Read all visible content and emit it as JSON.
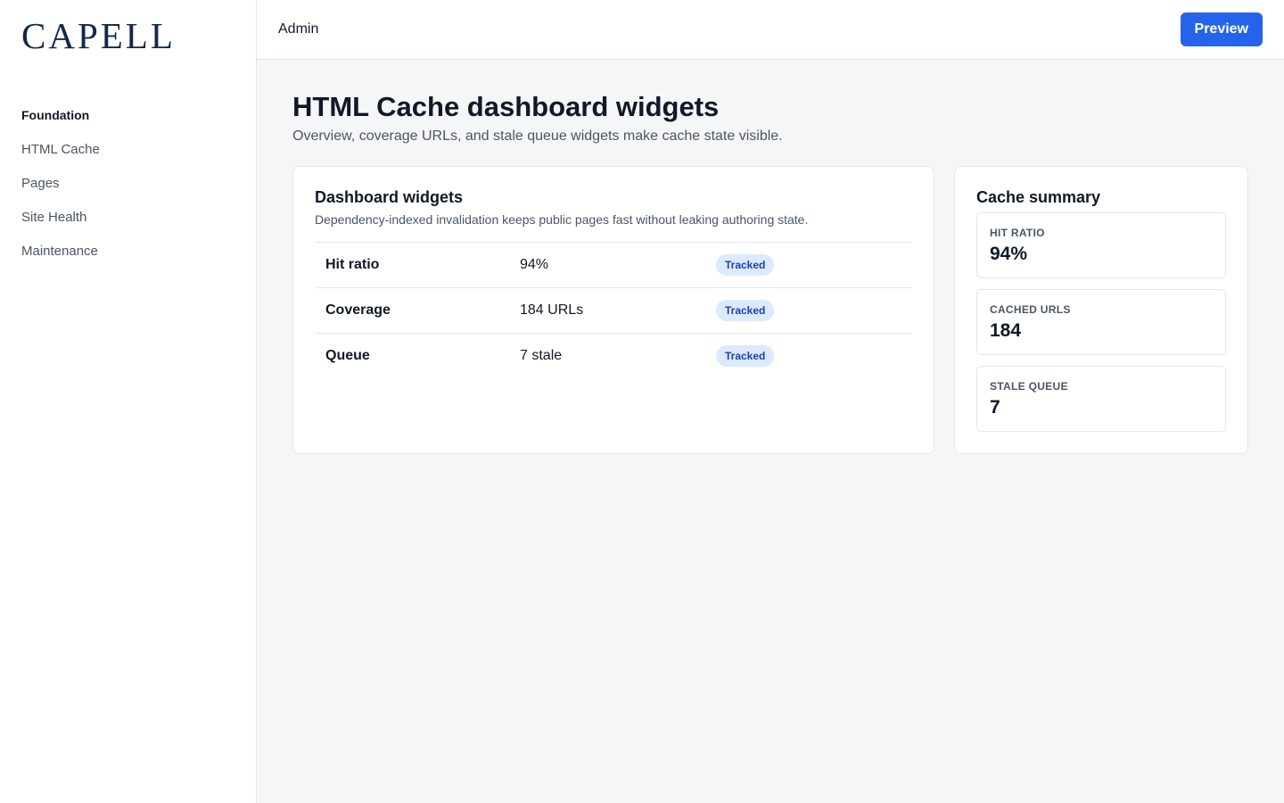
{
  "brand": {
    "logo_text": "CAPELL"
  },
  "sidebar": {
    "items": [
      {
        "label": "Foundation",
        "active": true
      },
      {
        "label": "HTML Cache",
        "active": false
      },
      {
        "label": "Pages",
        "active": false
      },
      {
        "label": "Site Health",
        "active": false
      },
      {
        "label": "Maintenance",
        "active": false
      }
    ]
  },
  "topbar": {
    "title": "Admin",
    "preview_label": "Preview"
  },
  "page": {
    "title": "HTML Cache dashboard widgets",
    "subtitle": "Overview, coverage URLs, and stale queue widgets make cache state visible."
  },
  "widgets": {
    "title": "Dashboard widgets",
    "description": "Dependency-indexed invalidation keeps public pages fast without leaking authoring state.",
    "rows": [
      {
        "label": "Hit ratio",
        "value": "94%",
        "status": "Tracked"
      },
      {
        "label": "Coverage",
        "value": "184 URLs",
        "status": "Tracked"
      },
      {
        "label": "Queue",
        "value": "7 stale",
        "status": "Tracked"
      }
    ]
  },
  "summary": {
    "title": "Cache summary",
    "stats": [
      {
        "label": "HIT RATIO",
        "value": "94%"
      },
      {
        "label": "CACHED URLS",
        "value": "184"
      },
      {
        "label": "STALE QUEUE",
        "value": "7"
      }
    ]
  },
  "colors": {
    "accent": "#2563eb",
    "brand": "#13284a",
    "badge_bg": "#dbeafe",
    "badge_text": "#1e40af",
    "page_bg": "#f5f6f8"
  }
}
